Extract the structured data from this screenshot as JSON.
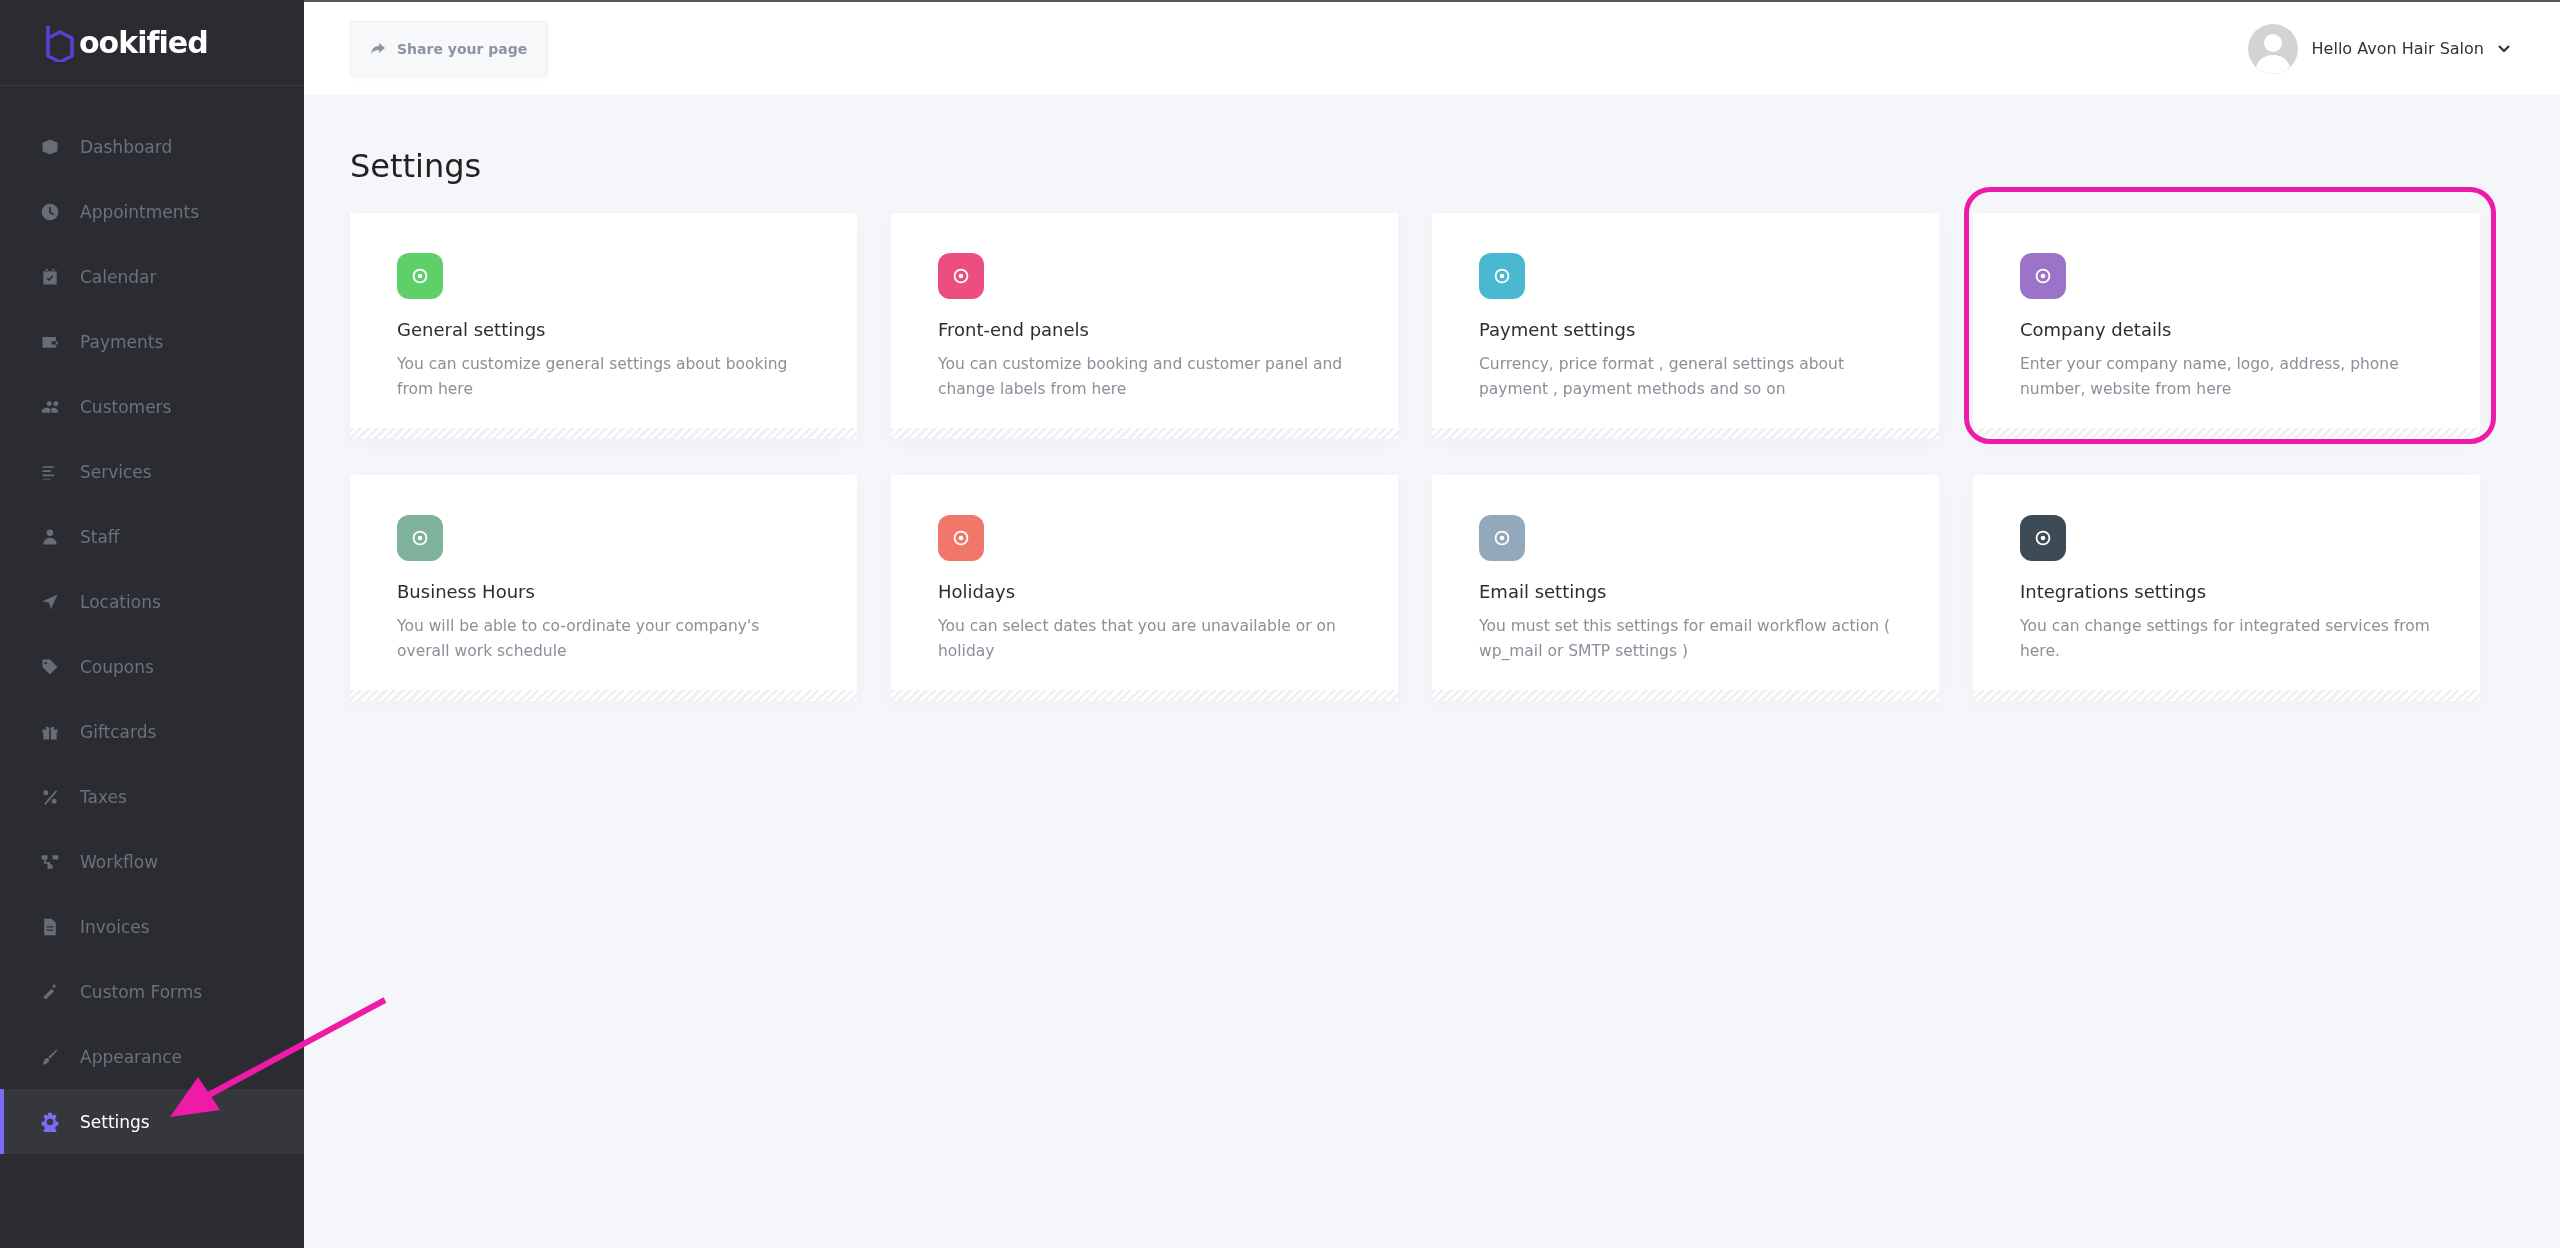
{
  "brand": {
    "name": "ookified"
  },
  "sidebar": {
    "items": [
      {
        "label": "Dashboard",
        "selected": false
      },
      {
        "label": "Appointments",
        "selected": false
      },
      {
        "label": "Calendar",
        "selected": false
      },
      {
        "label": "Payments",
        "selected": false
      },
      {
        "label": "Customers",
        "selected": false
      },
      {
        "label": "Services",
        "selected": false
      },
      {
        "label": "Staff",
        "selected": false
      },
      {
        "label": "Locations",
        "selected": false
      },
      {
        "label": "Coupons",
        "selected": false
      },
      {
        "label": "Giftcards",
        "selected": false
      },
      {
        "label": "Taxes",
        "selected": false
      },
      {
        "label": "Workflow",
        "selected": false
      },
      {
        "label": "Invoices",
        "selected": false
      },
      {
        "label": "Custom Forms",
        "selected": false
      },
      {
        "label": "Appearance",
        "selected": false
      },
      {
        "label": "Settings",
        "selected": true
      }
    ]
  },
  "topbar": {
    "share_button": "Share your page",
    "user": "Hello Avon Hair Salon"
  },
  "page_title": "Settings",
  "cards": [
    {
      "title": "General settings",
      "description": "You can customize general settings about booking from here",
      "color": "#5fcf6a",
      "highlighted": false
    },
    {
      "title": "Front-end panels",
      "description": "You can customize booking and customer panel and change labels from here",
      "color": "#ec4f7f",
      "highlighted": false
    },
    {
      "title": "Payment settings",
      "description": "Currency, price format , general settings about payment , payment methods and so on",
      "color": "#4bb8d1",
      "highlighted": false
    },
    {
      "title": "Company details",
      "description": "Enter your company name, logo, address, phone number, website from here",
      "color": "#9b74c9",
      "highlighted": true
    },
    {
      "title": "Business Hours",
      "description": "You will be able to co-ordinate your company's overall work schedule",
      "color": "#7fb29b",
      "highlighted": false
    },
    {
      "title": "Holidays",
      "description": "You can select dates that you are unavailable or on holiday",
      "color": "#f2776b",
      "highlighted": false
    },
    {
      "title": "Email settings",
      "description": "You must set this settings for email workflow action ( wp_mail or SMTP settings )",
      "color": "#94a8bc",
      "highlighted": false
    },
    {
      "title": "Integrations settings",
      "description": "You can change settings for integrated services from here.",
      "color": "#3d4b57",
      "highlighted": false
    }
  ]
}
